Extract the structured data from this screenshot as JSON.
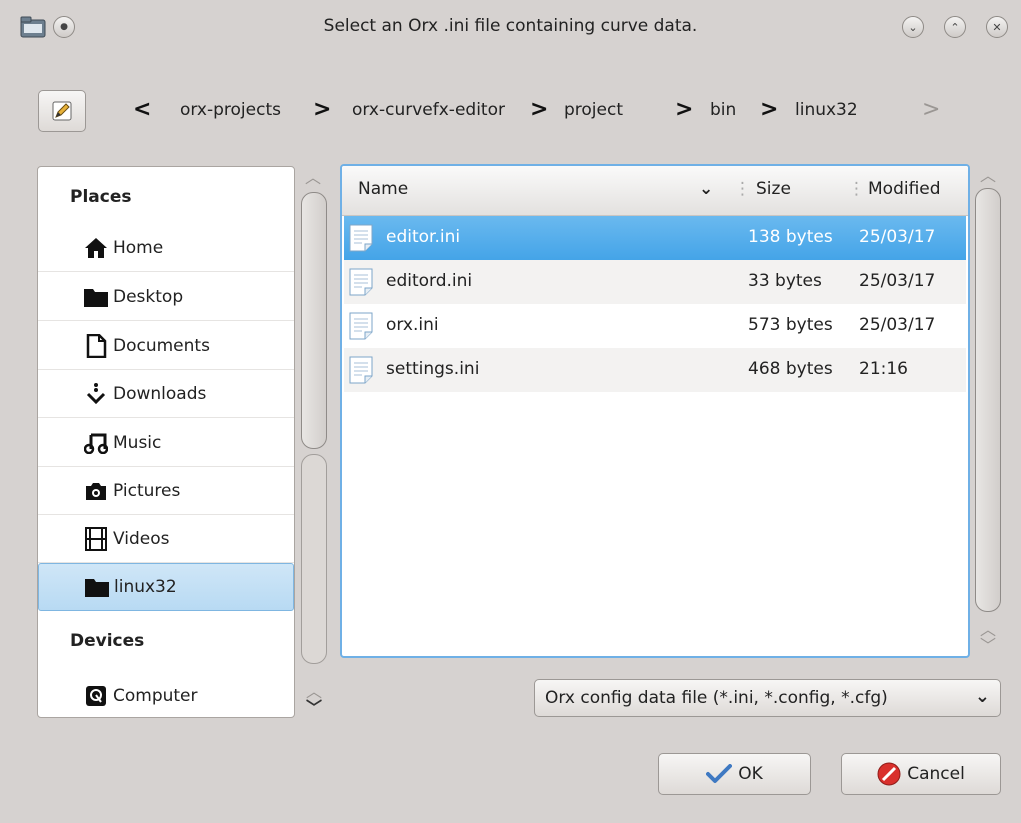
{
  "window": {
    "title": "Select an Orx .ini file containing curve data."
  },
  "breadcrumb": {
    "back_glyph": "<",
    "forward_glyph": ">",
    "separator": ">",
    "items": [
      "orx-projects",
      "orx-curvefx-editor",
      "project",
      "bin",
      "linux32"
    ]
  },
  "places": {
    "places_header": "Places",
    "devices_header": "Devices",
    "items": [
      {
        "label": "Home",
        "icon": "home-icon"
      },
      {
        "label": "Desktop",
        "icon": "folder-icon"
      },
      {
        "label": "Documents",
        "icon": "document-icon"
      },
      {
        "label": "Downloads",
        "icon": "download-icon"
      },
      {
        "label": "Music",
        "icon": "music-icon"
      },
      {
        "label": "Pictures",
        "icon": "camera-icon"
      },
      {
        "label": "Videos",
        "icon": "film-icon"
      },
      {
        "label": "linux32",
        "icon": "folder-icon",
        "selected": true
      }
    ],
    "devices": [
      {
        "label": "Computer",
        "icon": "computer-icon"
      }
    ]
  },
  "files": {
    "columns": {
      "name": "Name",
      "size": "Size",
      "modified": "Modified"
    },
    "rows": [
      {
        "name": "editor.ini",
        "size": "138 bytes",
        "modified": "25/03/17",
        "selected": true
      },
      {
        "name": "editord.ini",
        "size": "33 bytes",
        "modified": "25/03/17"
      },
      {
        "name": "orx.ini",
        "size": "573 bytes",
        "modified": "25/03/17"
      },
      {
        "name": "settings.ini",
        "size": "468 bytes",
        "modified": "21:16"
      }
    ]
  },
  "filter": {
    "selected": "Orx config data file (*.ini, *.config, *.cfg)"
  },
  "buttons": {
    "ok": "OK",
    "cancel": "Cancel"
  },
  "colors": {
    "accent": "#44a4e8",
    "selection_border": "#6fb0e6",
    "cancel_icon": "#d9302c",
    "ok_icon": "#3f79c2"
  }
}
